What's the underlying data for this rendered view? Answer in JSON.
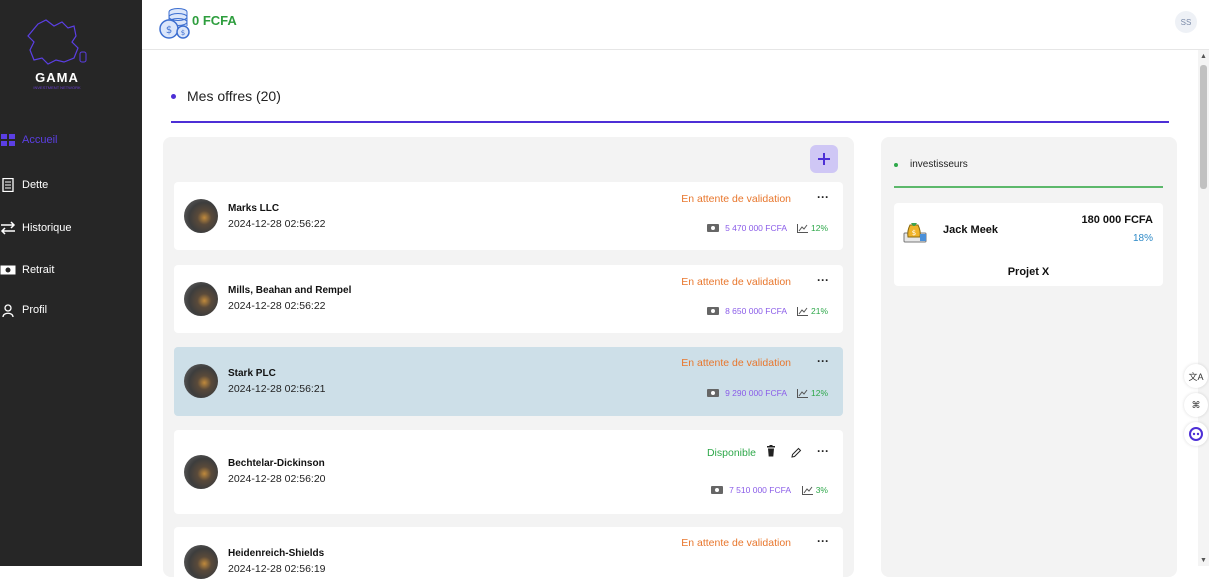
{
  "app": {
    "logo_text": "GAMA",
    "logo_sub": "INVESTMENT NETWORK"
  },
  "sidebar": {
    "items": [
      {
        "label": "Accueil",
        "icon": "grid-icon",
        "active": true
      },
      {
        "label": "Dette",
        "icon": "receipt-icon",
        "active": false
      },
      {
        "label": "Historique",
        "icon": "swap-icon",
        "active": false
      },
      {
        "label": "Retrait",
        "icon": "cash-icon",
        "active": false
      },
      {
        "label": "Profil",
        "icon": "user-icon",
        "active": false
      }
    ]
  },
  "header": {
    "balance": "0 FCFA",
    "user_initials": "SS"
  },
  "page": {
    "title": "Mes offres (20)"
  },
  "offers": [
    {
      "name": "Marks LLC",
      "date": "2024-12-28 02:56:22",
      "status": "En attente de validation",
      "amount": "5 470 000 FCFA",
      "rate": "12%"
    },
    {
      "name": "Mills, Beahan and Rempel",
      "date": "2024-12-28 02:56:22",
      "status": "En attente de validation",
      "amount": "8 650 000 FCFA",
      "rate": "21%"
    },
    {
      "name": "Stark PLC",
      "date": "2024-12-28 02:56:21",
      "status": "En attente de validation",
      "amount": "9 290 000 FCFA",
      "rate": "12%"
    },
    {
      "name": "Bechtelar-Dickinson",
      "date": "2024-12-28 02:56:20",
      "status": "Disponible",
      "amount": "7 510 000 FCFA",
      "rate": "3%"
    },
    {
      "name": "Heidenreich-Shields",
      "date": "2024-12-28 02:56:19",
      "status": "En attente de validation",
      "amount": "",
      "rate": ""
    }
  ],
  "investors": {
    "heading": "investisseurs",
    "list": [
      {
        "name": "Jack Meek",
        "amount": "180 000 FCFA",
        "rate": "18%",
        "project": "Projet X"
      }
    ]
  },
  "colors": {
    "accent": "#4d2fd6",
    "pending": "#e8762c",
    "available": "#2ea84a",
    "sidebar": "#262626"
  }
}
